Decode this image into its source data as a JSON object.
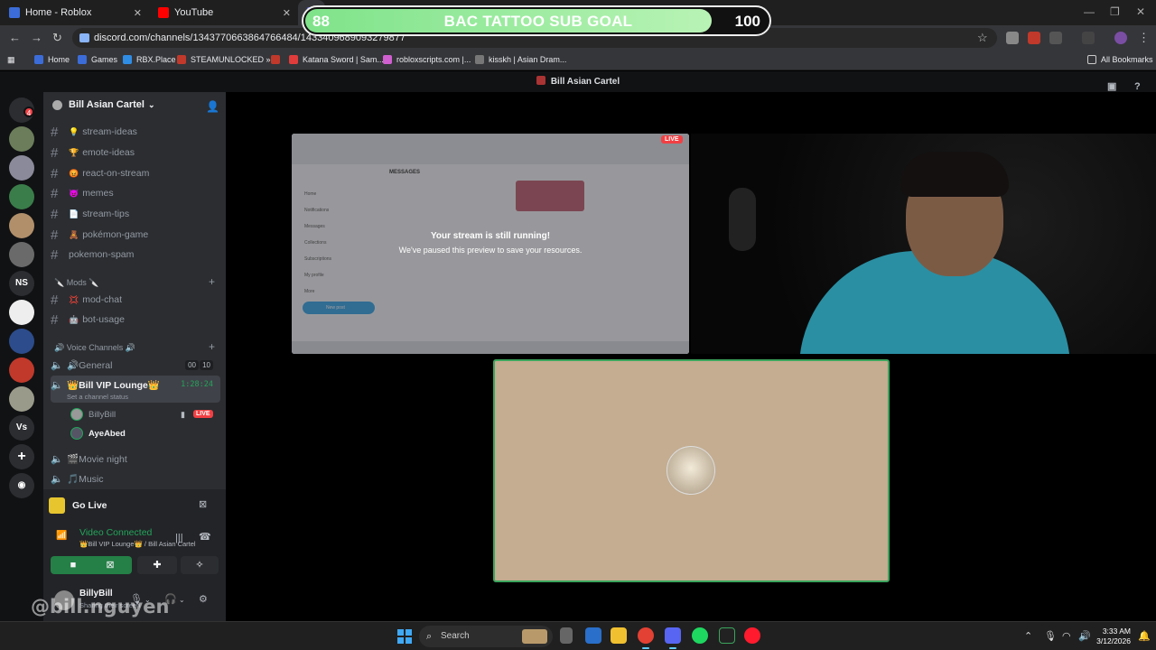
{
  "browser": {
    "tabs": [
      {
        "title": "Home - Roblox",
        "color": "#3b6cd8"
      },
      {
        "title": "YouTube",
        "color": "#ff0000"
      }
    ],
    "url": "discord.com/channels/1343770663864766484/1433409689093279877",
    "bookmarks": [
      {
        "label": "Home",
        "color": "#3b6cd8"
      },
      {
        "label": "Games",
        "color": "#3b6cd8"
      },
      {
        "label": "RBX.Place",
        "color": "#2f8de4"
      },
      {
        "label": "STEAMUNLOCKED »...",
        "color": "#c0392b"
      },
      {
        "label": "",
        "color": "#c0392b"
      },
      {
        "label": "Katana Sword | Sam...",
        "color": "#e03c3c"
      },
      {
        "label": "robloxscripts.com |...",
        "color": "#d05fd0"
      },
      {
        "label": "kisskh | Asian Dram...",
        "color": "#777777"
      }
    ],
    "all_bookmarks": "All Bookmarks"
  },
  "sub_goal": {
    "current": "88",
    "title": "BAC TATTOO SUB GOAL",
    "target": "100",
    "progress": 0.88
  },
  "discord": {
    "window_title": "Bill Asian Cartel",
    "rail_badge": "4",
    "rail_text_servers": [
      "NS",
      "Vs"
    ],
    "server_name": "Bill Asian Cartel",
    "text_channels": [
      {
        "emoji": "💡",
        "name": "stream-ideas"
      },
      {
        "emoji": "🏆",
        "name": "emote-ideas"
      },
      {
        "emoji": "😡",
        "name": "react-on-stream"
      },
      {
        "emoji": "😈",
        "name": "memes"
      },
      {
        "emoji": "📄",
        "name": "stream-tips"
      },
      {
        "emoji": "🧸",
        "name": "pokémon-game"
      },
      {
        "emoji": "",
        "name": "pokemon-spam"
      }
    ],
    "mods_category": "🔪 Mods 🔪",
    "mod_channels": [
      {
        "emoji": "💢",
        "name": "mod-chat"
      },
      {
        "emoji": "🤖",
        "name": "bot-usage"
      }
    ],
    "voice_category": "🔊 Voice Channels 🔊",
    "voice_general": {
      "name": "🔊General",
      "count_a": "00",
      "count_b": "10"
    },
    "voice_vip": {
      "name": "👑Bill VIP Lounge👑",
      "timer": "1:28:24",
      "status": "Set a channel status"
    },
    "voice_members": [
      {
        "name": "BillyBill",
        "live": "LIVE"
      },
      {
        "name": "AyeAbed"
      }
    ],
    "voice_more": [
      "🎬Movie night",
      "🎵Music"
    ],
    "panel": {
      "go_live": "Go Live",
      "video_connected": "Video Connected",
      "location": "👑Bill VIP Lounge👑 / Bill Asian Cartel",
      "username": "BillyBill",
      "user_status": "Sharing their screen"
    },
    "stream": {
      "live": "LIVE",
      "still_running": "Your stream is still running!",
      "paused": "We've paused this preview to save your resources.",
      "mini_nav": [
        "Home",
        "Notifications",
        "Messages",
        "Collections",
        "Subscriptions",
        "My profile",
        "More"
      ],
      "mini_header": "MESSAGES",
      "mini_post": "New post"
    }
  },
  "watermark": "@bill.nguyen",
  "taskbar": {
    "search": "Search",
    "time": "3:33 AM",
    "date": "3/12/2026"
  }
}
